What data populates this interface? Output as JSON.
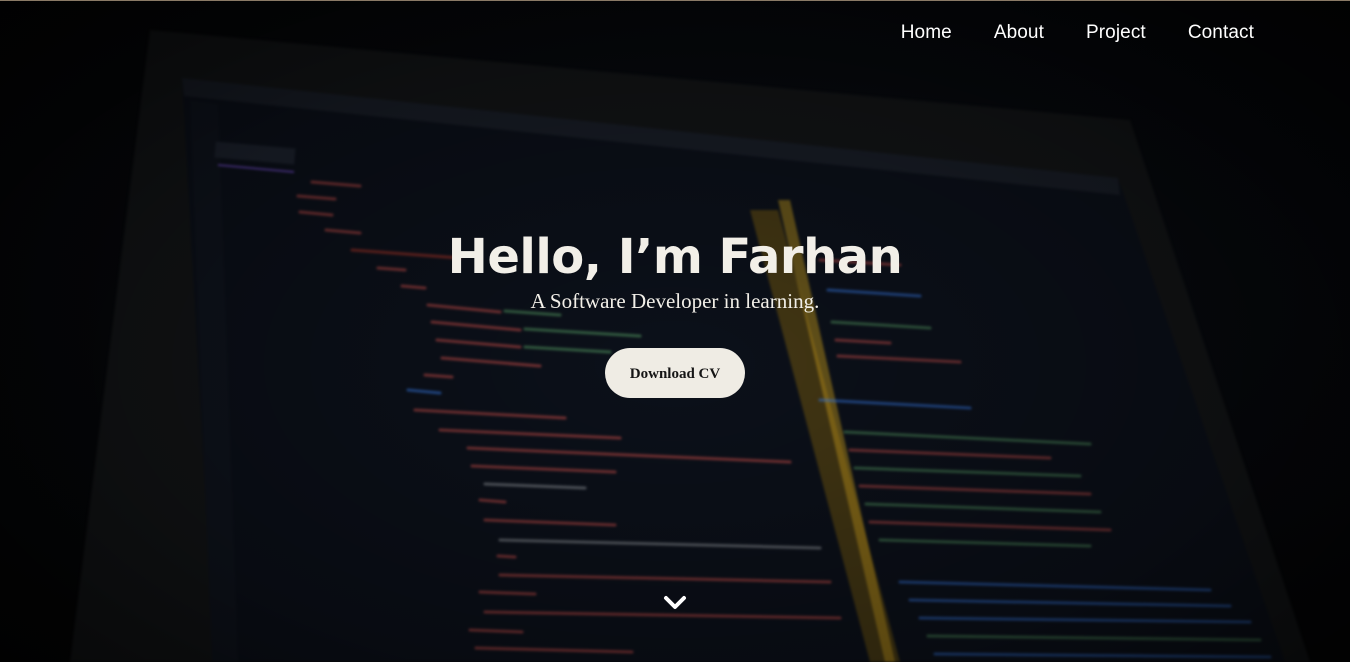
{
  "nav": {
    "items": [
      {
        "label": "Home"
      },
      {
        "label": "About"
      },
      {
        "label": "Project"
      },
      {
        "label": "Contact"
      }
    ]
  },
  "hero": {
    "title": "Hello, I’m Farhan",
    "subtitle": "A Software Developer in learning.",
    "cta_label": "Download CV",
    "scroll_icon": "chevron-down-icon"
  },
  "colors": {
    "text": "#f2efe8",
    "button_bg": "#efece4",
    "button_text": "#151515",
    "background": "#070707"
  }
}
